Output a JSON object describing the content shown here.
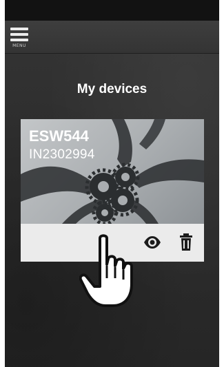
{
  "header": {
    "menu_label": "MENU",
    "icon": "hamburger-menu-icon"
  },
  "page": {
    "title": "My devices"
  },
  "device_card": {
    "name": "ESW544",
    "serial": "IN2302994",
    "image": "gears-hands-photo",
    "actions": {
      "view_icon": "eye-icon",
      "delete_icon": "trash-icon"
    }
  },
  "overlay": {
    "icon": "pointing-hand-cursor-icon"
  },
  "colors": {
    "background": "#2c2c2c",
    "topbar": "#3a3a3a",
    "text": "#ffffff",
    "actions_bar": "#ebebeb"
  }
}
